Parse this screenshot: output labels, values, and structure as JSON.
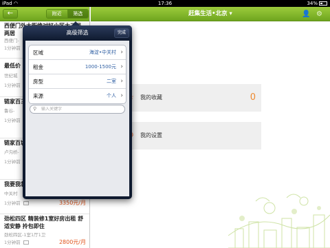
{
  "statusbar": {
    "device": "iPad",
    "wifi": "◠",
    "time": "17:36",
    "battery": "34%"
  },
  "left_panel": {
    "back_label": "←",
    "segments": [
      "附近",
      "筛选"
    ],
    "listings": [
      {
        "title": "西便门外大街绝对好小区大三居两居",
        "meta": "西便门-",
        "time": "1分钟前"
      },
      {
        "title": "最低价",
        "meta": "世纪城",
        "time": "1分钟前"
      },
      {
        "title": "链家百三居超",
        "meta": "鲁谷-",
        "time": "1分钟前"
      },
      {
        "title": "链家百城 精装",
        "meta": "卢沟桥-",
        "time": "1分钟前"
      },
      {
        "title": "我要我装一居",
        "meta": "中关村",
        "time": "1分钟前",
        "price": "3350元/月"
      },
      {
        "title": "劲松四区 精装修1室好房出租 舒适安静 拎包即住",
        "meta": "劲松四区-1室1厅1卫",
        "time": "1分钟前",
        "price": "2800元/月"
      }
    ]
  },
  "header": {
    "title": "赶集生活•北京 ▾",
    "user_icon": "👤",
    "gear_icon": "⚙"
  },
  "main": {
    "favorites": {
      "label": "我的收藏",
      "count": "0",
      "icon": "☆"
    },
    "settings": {
      "label": "我的设置",
      "icon": "⚙"
    }
  },
  "popover": {
    "title": "高级筛选",
    "done_label": "完成",
    "options": [
      {
        "key": "区域",
        "value": "海淀•中关村"
      },
      {
        "key": "租金",
        "value": "1000-1500元"
      },
      {
        "key": "房型",
        "value": "二室"
      },
      {
        "key": "来源",
        "value": "个人"
      }
    ],
    "chevron": "›",
    "search_placeholder": "输入关键字",
    "search_icon": "⚲"
  }
}
